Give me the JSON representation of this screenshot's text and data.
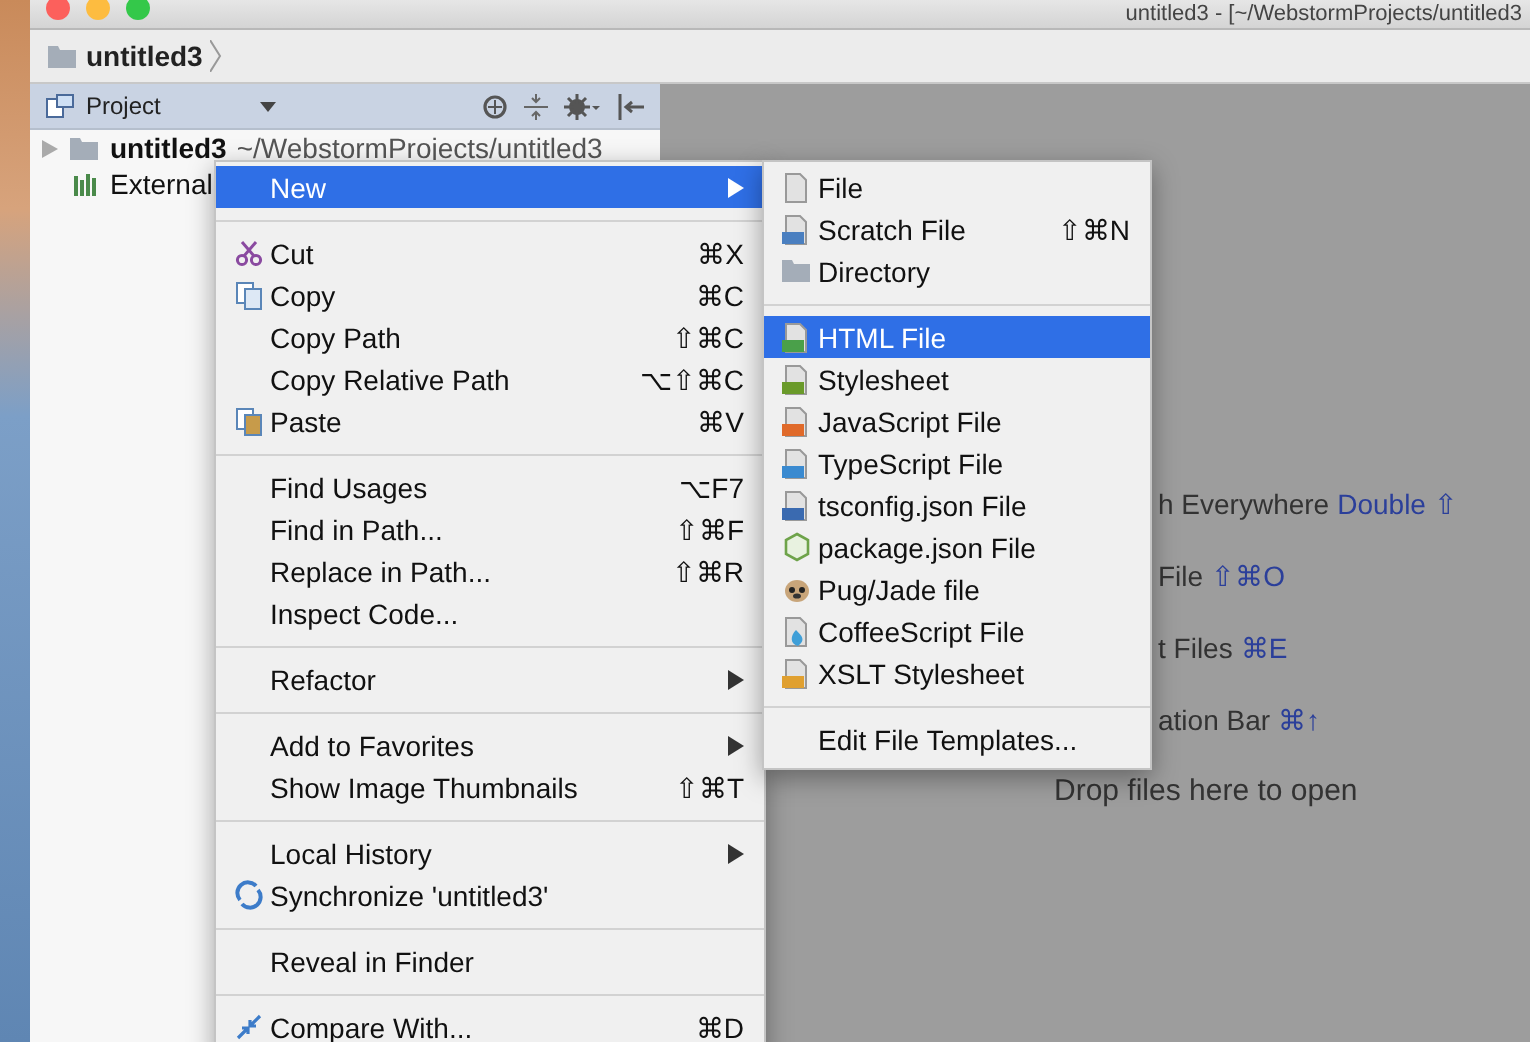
{
  "window": {
    "title": "untitled3 - [~/WebstormProjects/untitled3"
  },
  "navbar": {
    "crumb": "untitled3"
  },
  "project_panel": {
    "title": "Project",
    "tree": [
      {
        "label": "untitled3",
        "path": "~/WebstormProjects/untitled3",
        "expanded": false
      },
      {
        "label": "External"
      }
    ]
  },
  "editor_hints": [
    {
      "text": "h Everywhere",
      "shortcut": "Double ⇧"
    },
    {
      "text": "File",
      "shortcut": "⇧⌘O"
    },
    {
      "text": "t Files",
      "shortcut": "⌘E"
    },
    {
      "text": "ation Bar",
      "shortcut": "⌘↑"
    },
    {
      "text": "Drop files here to open"
    }
  ],
  "context_menu": [
    [
      {
        "label": "New",
        "submenu": true,
        "selected": true
      }
    ],
    [
      {
        "label": "Cut",
        "shortcut": "⌘X",
        "submenu": false,
        "selected": false
      },
      {
        "label": "Copy",
        "shortcut": "⌘C",
        "submenu": false,
        "selected": false
      },
      {
        "label": "Copy Path",
        "shortcut": "⇧⌘C",
        "submenu": false,
        "selected": false
      },
      {
        "label": "Copy Relative Path",
        "shortcut": "⌥⇧⌘C",
        "submenu": false,
        "selected": false
      },
      {
        "label": "Paste",
        "shortcut": "⌘V",
        "submenu": false,
        "selected": false
      }
    ],
    [
      {
        "label": "Find Usages",
        "shortcut": "⌥F7",
        "submenu": false,
        "selected": false
      },
      {
        "label": "Find in Path...",
        "shortcut": "⇧⌘F",
        "submenu": false,
        "selected": false
      },
      {
        "label": "Replace in Path...",
        "shortcut": "⇧⌘R",
        "submenu": false,
        "selected": false
      },
      {
        "label": "Inspect Code...",
        "submenu": false,
        "selected": false
      }
    ],
    [
      {
        "label": "Refactor",
        "submenu": true,
        "selected": false
      }
    ],
    [
      {
        "label": "Add to Favorites",
        "submenu": true,
        "selected": false
      },
      {
        "label": "Show Image Thumbnails",
        "shortcut": "⇧⌘T",
        "submenu": false,
        "selected": false
      }
    ],
    [
      {
        "label": "Local History",
        "submenu": true,
        "selected": false
      },
      {
        "label": "Synchronize 'untitled3'",
        "submenu": false,
        "selected": false
      }
    ],
    [
      {
        "label": "Reveal in Finder",
        "submenu": false,
        "selected": false
      }
    ],
    [
      {
        "label": "Compare With...",
        "shortcut": "⌘D",
        "submenu": false,
        "selected": false
      }
    ]
  ],
  "new_submenu": [
    [
      {
        "label": "File",
        "selected": false
      },
      {
        "label": "Scratch File",
        "shortcut": "⇧⌘N",
        "selected": false
      },
      {
        "label": "Directory",
        "selected": false
      }
    ],
    [
      {
        "label": "HTML File",
        "selected": true
      },
      {
        "label": "Stylesheet",
        "selected": false
      },
      {
        "label": "JavaScript File",
        "selected": false
      },
      {
        "label": "TypeScript File",
        "selected": false
      },
      {
        "label": "tsconfig.json File",
        "selected": false
      },
      {
        "label": "package.json File",
        "selected": false
      },
      {
        "label": "Pug/Jade file",
        "selected": false
      },
      {
        "label": "CoffeeScript File",
        "selected": false
      },
      {
        "label": "XSLT Stylesheet",
        "selected": false
      }
    ],
    [
      {
        "label": "Edit File Templates...",
        "selected": false
      }
    ]
  ]
}
